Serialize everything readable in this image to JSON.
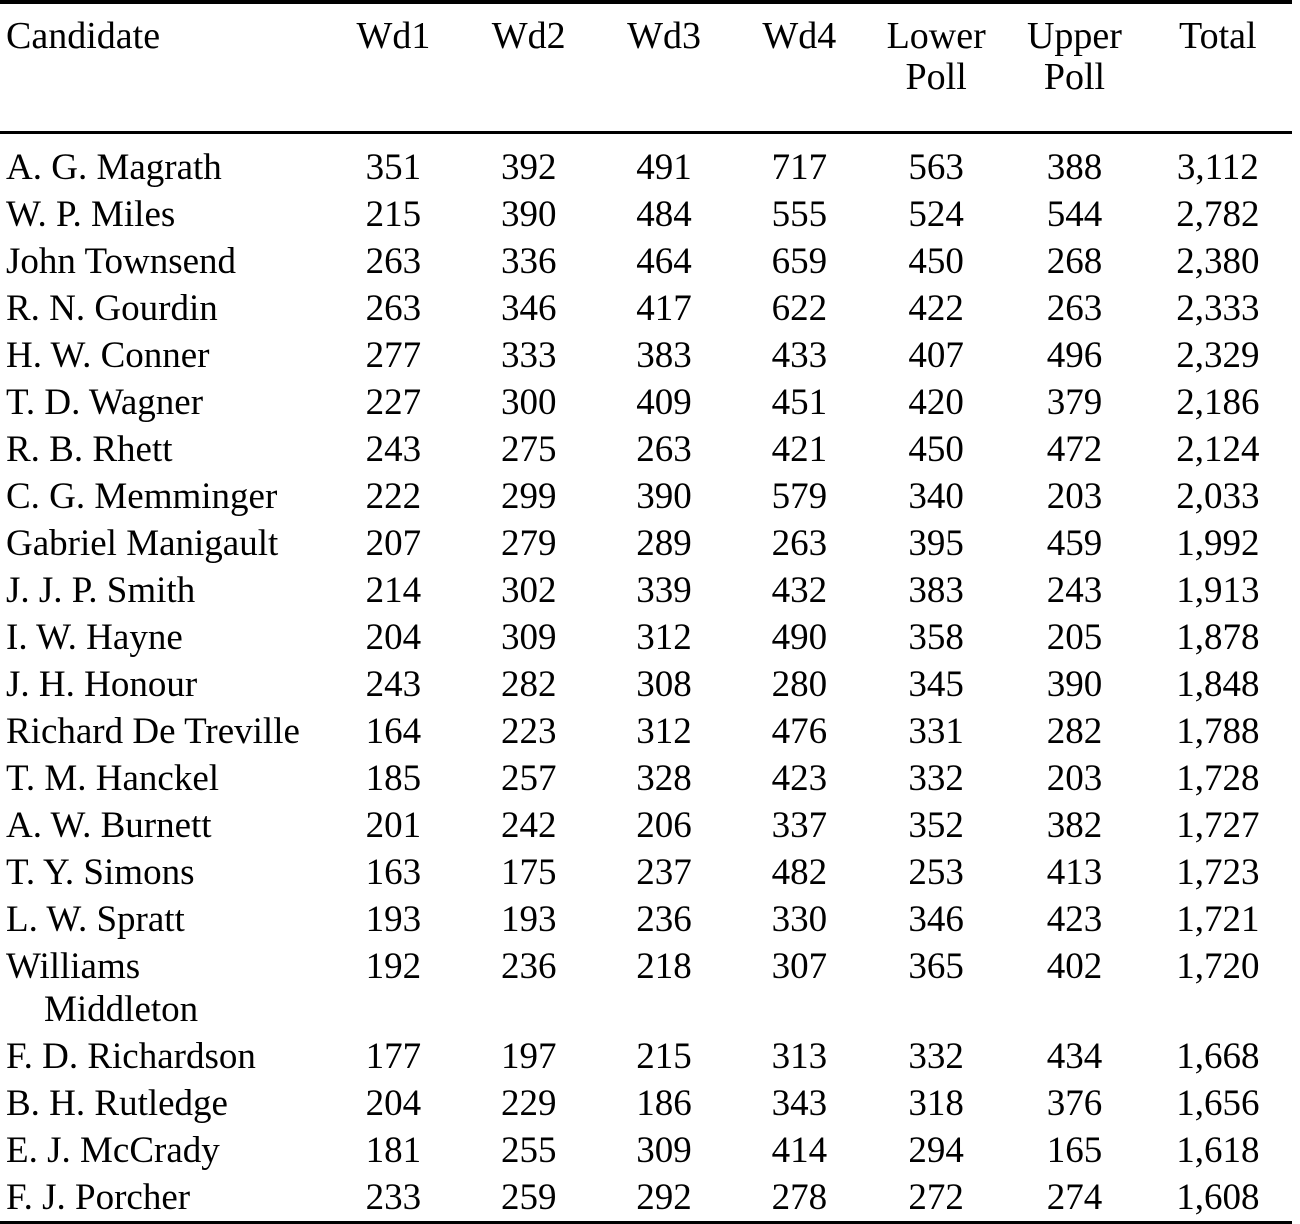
{
  "table": {
    "columns": [
      {
        "key": "candidate",
        "label": "Candidate",
        "align": "left"
      },
      {
        "key": "wd1",
        "label": "Wd1",
        "align": "center"
      },
      {
        "key": "wd2",
        "label": "Wd2",
        "align": "center"
      },
      {
        "key": "wd3",
        "label": "Wd3",
        "align": "center"
      },
      {
        "key": "wd4",
        "label": "Wd4",
        "align": "center"
      },
      {
        "key": "lower_poll",
        "label": "Lower\nPoll",
        "align": "center"
      },
      {
        "key": "upper_poll",
        "label": "Upper\nPoll",
        "align": "center"
      },
      {
        "key": "total",
        "label": "Total",
        "align": "center"
      }
    ],
    "headers": {
      "candidate": "Candidate",
      "wd1": "Wd1",
      "wd2": "Wd2",
      "wd3": "Wd3",
      "wd4": "Wd4",
      "lower_poll_line1": "Lower",
      "lower_poll_line2": "Poll",
      "upper_poll_line1": "Upper",
      "upper_poll_line2": "Poll",
      "total": "Total"
    },
    "rows": [
      {
        "candidate": "A. G. Magrath",
        "candidate_line2": "",
        "wd1": "351",
        "wd2": "392",
        "wd3": "491",
        "wd4": "717",
        "lower_poll": "563",
        "upper_poll": "388",
        "total": "3,112"
      },
      {
        "candidate": "W. P. Miles",
        "candidate_line2": "",
        "wd1": "215",
        "wd2": "390",
        "wd3": "484",
        "wd4": "555",
        "lower_poll": "524",
        "upper_poll": "544",
        "total": "2,782"
      },
      {
        "candidate": "John Townsend",
        "candidate_line2": "",
        "wd1": "263",
        "wd2": "336",
        "wd3": "464",
        "wd4": "659",
        "lower_poll": "450",
        "upper_poll": "268",
        "total": "2,380"
      },
      {
        "candidate": "R. N. Gourdin",
        "candidate_line2": "",
        "wd1": "263",
        "wd2": "346",
        "wd3": "417",
        "wd4": "622",
        "lower_poll": "422",
        "upper_poll": "263",
        "total": "2,333"
      },
      {
        "candidate": "H. W. Conner",
        "candidate_line2": "",
        "wd1": "277",
        "wd2": "333",
        "wd3": "383",
        "wd4": "433",
        "lower_poll": "407",
        "upper_poll": "496",
        "total": "2,329"
      },
      {
        "candidate": "T. D. Wagner",
        "candidate_line2": "",
        "wd1": "227",
        "wd2": "300",
        "wd3": "409",
        "wd4": "451",
        "lower_poll": "420",
        "upper_poll": "379",
        "total": "2,186"
      },
      {
        "candidate": "R. B. Rhett",
        "candidate_line2": "",
        "wd1": "243",
        "wd2": "275",
        "wd3": "263",
        "wd4": "421",
        "lower_poll": "450",
        "upper_poll": "472",
        "total": "2,124"
      },
      {
        "candidate": "C. G. Memminger",
        "candidate_line2": "",
        "wd1": "222",
        "wd2": "299",
        "wd3": "390",
        "wd4": "579",
        "lower_poll": "340",
        "upper_poll": "203",
        "total": "2,033"
      },
      {
        "candidate": "Gabriel Manigault",
        "candidate_line2": "",
        "wd1": "207",
        "wd2": "279",
        "wd3": "289",
        "wd4": "263",
        "lower_poll": "395",
        "upper_poll": "459",
        "total": "1,992"
      },
      {
        "candidate": "J. J. P. Smith",
        "candidate_line2": "",
        "wd1": "214",
        "wd2": "302",
        "wd3": "339",
        "wd4": "432",
        "lower_poll": "383",
        "upper_poll": "243",
        "total": "1,913"
      },
      {
        "candidate": "I. W. Hayne",
        "candidate_line2": "",
        "wd1": "204",
        "wd2": "309",
        "wd3": "312",
        "wd4": "490",
        "lower_poll": "358",
        "upper_poll": "205",
        "total": "1,878"
      },
      {
        "candidate": "J. H. Honour",
        "candidate_line2": "",
        "wd1": "243",
        "wd2": "282",
        "wd3": "308",
        "wd4": "280",
        "lower_poll": "345",
        "upper_poll": "390",
        "total": "1,848"
      },
      {
        "candidate": "Richard De Treville",
        "candidate_line2": "",
        "wd1": "164",
        "wd2": "223",
        "wd3": "312",
        "wd4": "476",
        "lower_poll": "331",
        "upper_poll": "282",
        "total": "1,788"
      },
      {
        "candidate": "T. M. Hanckel",
        "candidate_line2": "",
        "wd1": "185",
        "wd2": "257",
        "wd3": "328",
        "wd4": "423",
        "lower_poll": "332",
        "upper_poll": "203",
        "total": "1,728"
      },
      {
        "candidate": "A. W. Burnett",
        "candidate_line2": "",
        "wd1": "201",
        "wd2": "242",
        "wd3": "206",
        "wd4": "337",
        "lower_poll": "352",
        "upper_poll": "382",
        "total": "1,727"
      },
      {
        "candidate": "T. Y. Simons",
        "candidate_line2": "",
        "wd1": "163",
        "wd2": "175",
        "wd3": "237",
        "wd4": "482",
        "lower_poll": "253",
        "upper_poll": "413",
        "total": "1,723"
      },
      {
        "candidate": "L. W. Spratt",
        "candidate_line2": "",
        "wd1": "193",
        "wd2": "193",
        "wd3": "236",
        "wd4": "330",
        "lower_poll": "346",
        "upper_poll": "423",
        "total": "1,721"
      },
      {
        "candidate": "Williams",
        "candidate_line2": "Middleton",
        "wd1": "192",
        "wd2": "236",
        "wd3": "218",
        "wd4": "307",
        "lower_poll": "365",
        "upper_poll": "402",
        "total": "1,720"
      },
      {
        "candidate": "F. D. Richardson",
        "candidate_line2": "",
        "wd1": "177",
        "wd2": "197",
        "wd3": "215",
        "wd4": "313",
        "lower_poll": "332",
        "upper_poll": "434",
        "total": "1,668"
      },
      {
        "candidate": "B. H. Rutledge",
        "candidate_line2": "",
        "wd1": "204",
        "wd2": "229",
        "wd3": "186",
        "wd4": "343",
        "lower_poll": "318",
        "upper_poll": "376",
        "total": "1,656"
      },
      {
        "candidate": "E. J. McCrady",
        "candidate_line2": "",
        "wd1": "181",
        "wd2": "255",
        "wd3": "309",
        "wd4": "414",
        "lower_poll": "294",
        "upper_poll": "165",
        "total": "1,618"
      },
      {
        "candidate": "F. J. Porcher",
        "candidate_line2": "",
        "wd1": "233",
        "wd2": "259",
        "wd3": "292",
        "wd4": "278",
        "lower_poll": "272",
        "upper_poll": "274",
        "total": "1,608"
      }
    ]
  },
  "style": {
    "text_color": "#000000",
    "background_color": "#ffffff",
    "rule_color": "#000000"
  }
}
